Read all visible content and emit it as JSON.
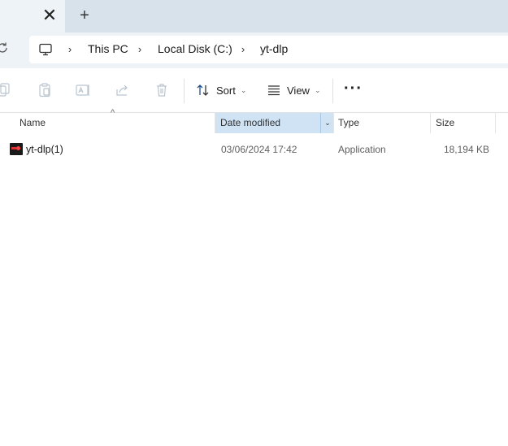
{
  "tabbar": {
    "close_glyph": "✕",
    "new_tab_glyph": "+"
  },
  "address": {
    "refresh_icon": "refresh-icon",
    "root_icon": "this-pc-icon",
    "separator_glyph": "›",
    "breadcrumbs": [
      "This PC",
      "Local Disk (C:)",
      "yt-dlp"
    ]
  },
  "toolbar": {
    "icons": [
      "copy-icon",
      "paste-icon",
      "rename-icon",
      "share-icon",
      "delete-icon"
    ],
    "sort_label": "Sort",
    "view_label": "View",
    "more_label": "···"
  },
  "columns": {
    "name": "Name",
    "date_modified": "Date modified",
    "type": "Type",
    "size": "Size",
    "active": "date_modified"
  },
  "files": [
    {
      "name": "yt-dlp(1)",
      "date_modified": "03/06/2024 17:42",
      "type": "Application",
      "size": "18,194 KB",
      "icon": "application-icon"
    }
  ],
  "colors": {
    "accent": "#cfe3f5",
    "tabstrip": "#d8e2ea",
    "address_bg": "#eef3f7"
  }
}
